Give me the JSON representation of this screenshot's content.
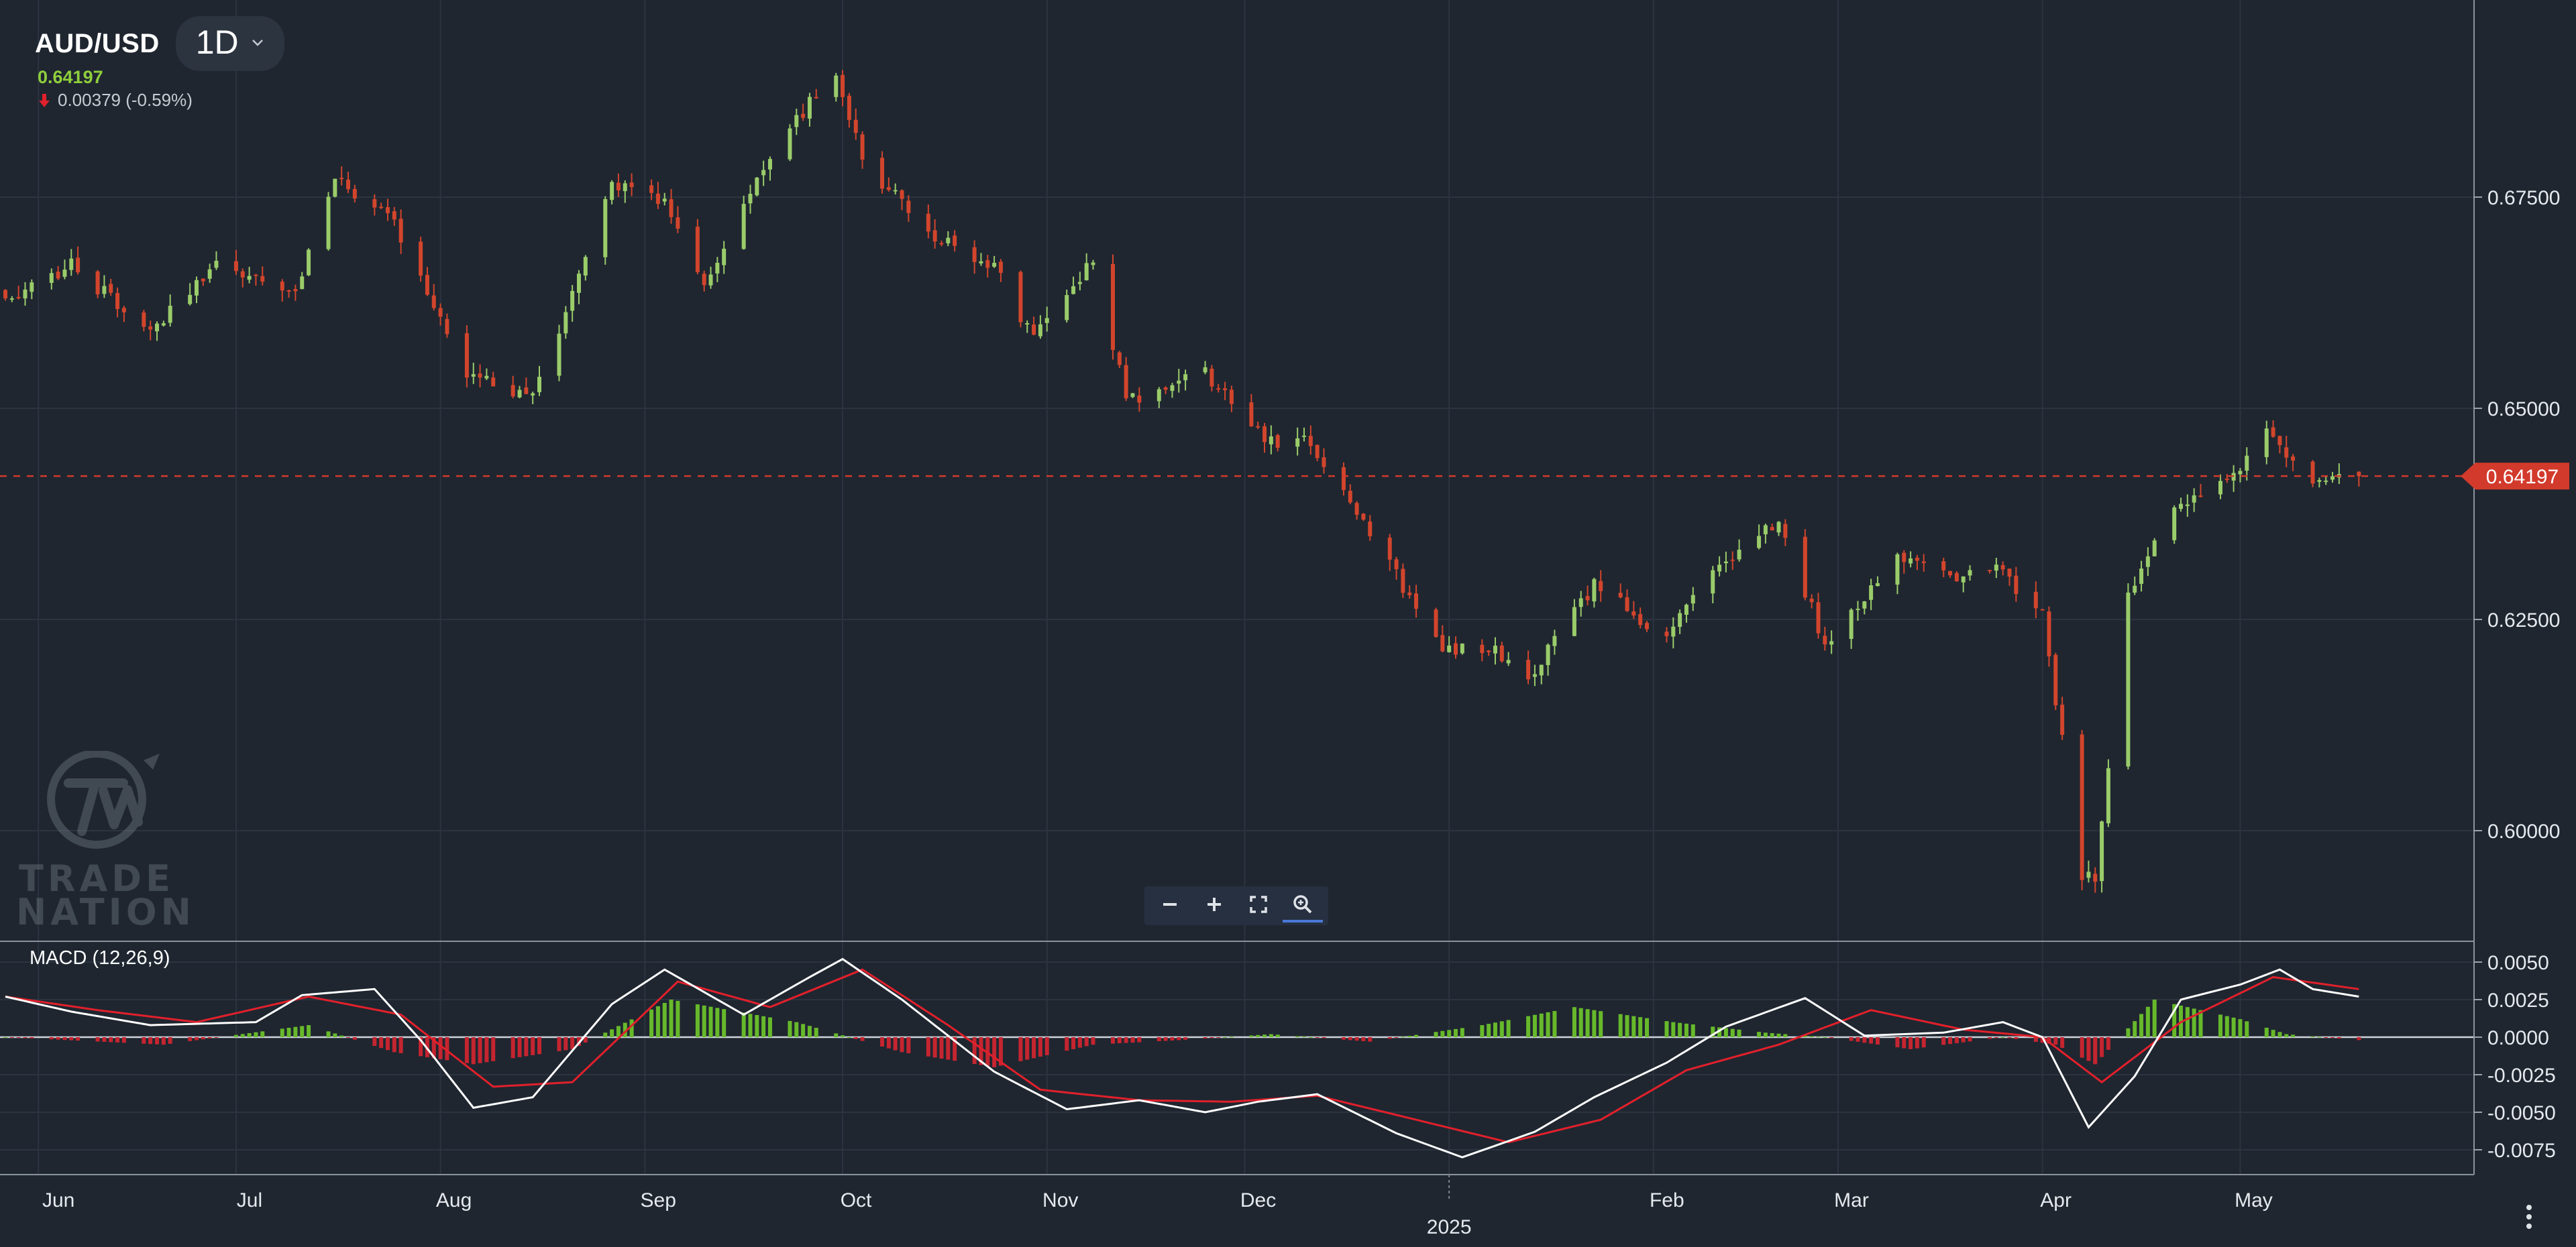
{
  "header": {
    "symbol": "AUD/USD",
    "timeframe": "1D",
    "last_price": "0.64197",
    "change": "0.00379 (-0.59%)"
  },
  "indicator": {
    "label": "MACD (12,26,9)"
  },
  "price_tag": "0.64197",
  "logo_text": [
    "TRADE",
    "NATION"
  ],
  "icons": {
    "timeframe_dropdown": "chevron-down-icon",
    "change_direction": "arrow-down-icon",
    "zoom_out": "minus-icon",
    "zoom_in": "plus-icon",
    "fit": "fullscreen-icon",
    "zoom_reset": "magnifier-icon",
    "menu": "vertical-dots-icon"
  },
  "colors": {
    "background": "#1f2630",
    "up": "#9acc6a",
    "down": "#d2452c",
    "macd_line": "#ffffff",
    "signal_line": "#e2202b",
    "hist_up": "#67b92b",
    "hist_down": "#c42530",
    "price_tag": "#d23a2c"
  },
  "chart_data": [
    {
      "type": "candlestick",
      "title": "AUD/USD",
      "y_ticks": [
        "0.60000",
        "0.62500",
        "0.65000",
        "0.67500"
      ],
      "x_ticks": [
        "Jun",
        "Jul",
        "Aug",
        "Sep",
        "Oct",
        "Nov",
        "Dec",
        "2025",
        "Feb",
        "Mar",
        "Apr",
        "May"
      ],
      "ylim": [
        0.5915,
        0.69
      ],
      "last_price": 0.64197,
      "x_dates": [
        "2024-05-27",
        "2024-06-06",
        "2024-06-18",
        "2024-06-28",
        "2024-07-10",
        "2024-07-16",
        "2024-07-25",
        "2024-08-05",
        "2024-08-15",
        "2024-08-27",
        "2024-09-04",
        "2024-09-10",
        "2024-09-20",
        "2024-09-30",
        "2024-10-04",
        "2024-10-14",
        "2024-10-24",
        "2024-10-30",
        "2024-11-08",
        "2024-11-13",
        "2024-11-25",
        "2024-12-05",
        "2024-12-10",
        "2024-12-18",
        "2024-12-31",
        "2025-01-07",
        "2025-01-13",
        "2025-01-23",
        "2025-02-03",
        "2025-02-12",
        "2025-02-20",
        "2025-02-27",
        "2025-03-10",
        "2025-03-17",
        "2025-03-25",
        "2025-04-01",
        "2025-04-07",
        "2025-04-09",
        "2025-04-14",
        "2025-04-21",
        "2025-04-29",
        "2025-05-05",
        "2025-05-12",
        "2025-05-19"
      ],
      "price_path": [
        0.663,
        0.667,
        0.659,
        0.667,
        0.664,
        0.677,
        0.672,
        0.654,
        0.651,
        0.677,
        0.674,
        0.664,
        0.68,
        0.69,
        0.679,
        0.671,
        0.667,
        0.658,
        0.668,
        0.651,
        0.654,
        0.646,
        0.646,
        0.638,
        0.621,
        0.622,
        0.618,
        0.629,
        0.623,
        0.632,
        0.637,
        0.622,
        0.632,
        0.63,
        0.631,
        0.626,
        0.595,
        0.594,
        0.628,
        0.639,
        0.641,
        0.648,
        0.641,
        0.642
      ]
    },
    {
      "type": "line",
      "title": "MACD (12,26,9)",
      "y_ticks": [
        "0.0050",
        "0.0025",
        "0.0000",
        "-0.0025",
        "-0.0050",
        "-0.0075"
      ],
      "ylim": [
        -0.009,
        0.0065
      ],
      "series": [
        {
          "name": "MACD",
          "x": [
            "2024-05-27",
            "2024-06-06",
            "2024-06-18",
            "2024-07-04",
            "2024-07-11",
            "2024-07-22",
            "2024-07-29",
            "2024-08-06",
            "2024-08-15",
            "2024-08-27",
            "2024-09-04",
            "2024-09-16",
            "2024-09-26",
            "2024-10-01",
            "2024-10-10",
            "2024-10-24",
            "2024-11-04",
            "2024-11-15",
            "2024-11-25",
            "2024-12-03",
            "2024-12-12",
            "2024-12-24",
            "2025-01-03",
            "2025-01-14",
            "2025-01-23",
            "2025-02-03",
            "2025-02-12",
            "2025-02-24",
            "2025-03-05",
            "2025-03-17",
            "2025-03-26",
            "2025-04-01",
            "2025-04-08",
            "2025-04-15",
            "2025-04-22",
            "2025-05-01",
            "2025-05-07",
            "2025-05-12",
            "2025-05-19"
          ],
          "values": [
            0.0027,
            0.0017,
            0.0008,
            0.001,
            0.0028,
            0.0032,
            -0.0002,
            -0.0047,
            -0.004,
            0.0022,
            0.0045,
            0.0015,
            0.004,
            0.0052,
            0.0025,
            -0.0023,
            -0.0048,
            -0.0042,
            -0.005,
            -0.0043,
            -0.0038,
            -0.0064,
            -0.008,
            -0.0063,
            -0.004,
            -0.0017,
            0.0007,
            0.0026,
            0.0001,
            0.0003,
            0.001,
            0.0,
            -0.006,
            -0.0026,
            0.0025,
            0.0035,
            0.0045,
            0.0032,
            0.0027
          ]
        },
        {
          "name": "Signal",
          "x": [
            "2024-05-27",
            "2024-06-10",
            "2024-06-25",
            "2024-07-12",
            "2024-07-26",
            "2024-08-09",
            "2024-08-21",
            "2024-09-06",
            "2024-09-20",
            "2024-10-04",
            "2024-10-17",
            "2024-10-31",
            "2024-11-15",
            "2024-11-29",
            "2024-12-12",
            "2024-12-27",
            "2025-01-10",
            "2025-01-24",
            "2025-02-06",
            "2025-02-20",
            "2025-03-06",
            "2025-03-20",
            "2025-04-01",
            "2025-04-10",
            "2025-04-22",
            "2025-05-06",
            "2025-05-19"
          ],
          "values": [
            0.0027,
            0.0018,
            0.001,
            0.0027,
            0.0015,
            -0.0033,
            -0.003,
            0.0037,
            0.002,
            0.0045,
            0.0008,
            -0.0035,
            -0.0042,
            -0.0043,
            -0.0039,
            -0.0055,
            -0.007,
            -0.0055,
            -0.0022,
            -0.0005,
            0.0018,
            0.0005,
            0.0,
            -0.003,
            0.001,
            0.004,
            0.0032
          ]
        }
      ],
      "histogram": {
        "x": [
          "2024-05-27",
          "2024-06-20",
          "2024-07-12",
          "2024-07-25",
          "2024-08-06",
          "2024-08-21",
          "2024-09-05",
          "2024-09-24",
          "2024-10-10",
          "2024-10-24",
          "2024-11-08",
          "2024-11-21",
          "2024-12-05",
          "2024-12-20",
          "2025-01-06",
          "2025-01-20",
          "2025-02-04",
          "2025-02-18",
          "2025-02-27",
          "2025-03-12",
          "2025-03-26",
          "2025-04-03",
          "2025-04-09",
          "2025-04-18",
          "2025-05-01",
          "2025-05-08",
          "2025-05-19"
        ],
        "values": [
          0.0,
          -0.0005,
          0.0008,
          -0.001,
          -0.0018,
          -0.0008,
          0.0025,
          0.001,
          -0.001,
          -0.002,
          -0.0005,
          -0.0002,
          0.0002,
          -0.0003,
          0.0008,
          0.002,
          0.001,
          0.0003,
          0.0,
          -0.0008,
          0.0,
          -0.0005,
          -0.0018,
          0.0025,
          0.0012,
          0.0002,
          -0.0002
        ]
      }
    }
  ]
}
